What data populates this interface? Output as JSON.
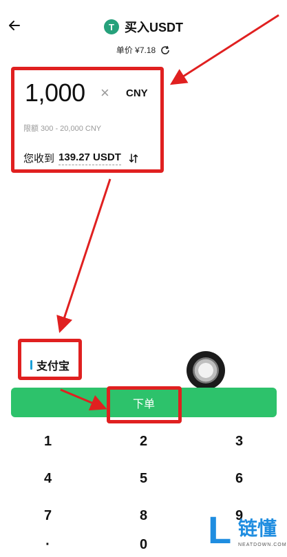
{
  "header": {
    "back_icon": "arrow-left-icon",
    "coin_icon_glyph": "T",
    "coin_icon": "tether-icon",
    "coin_color": "#26a17b",
    "title": "买入USDT"
  },
  "price": {
    "label": "单价 ¥7.18",
    "refresh_icon": "refresh-icon"
  },
  "order_form": {
    "amount": "1,000",
    "clear_glyph": "×",
    "currency": "CNY",
    "limit": "限额 300 - 20,000 CNY",
    "receive_label": "您收到",
    "receive_value": "139.27 USDT",
    "swap_icon": "swap-icon"
  },
  "payment": {
    "method": "支付宝",
    "accent": "#1a9fd8"
  },
  "submit": {
    "label": "下单",
    "color": "#2dc26b"
  },
  "keypad": {
    "keys": [
      "1",
      "2",
      "3",
      "4",
      "5",
      "6",
      "7",
      "8",
      "9",
      "·",
      "0",
      ""
    ]
  },
  "watermark": {
    "logo_letter": "L",
    "text": "链懂",
    "subtext": "NEATDOWN.COM"
  },
  "annotation_color": "#e02020"
}
